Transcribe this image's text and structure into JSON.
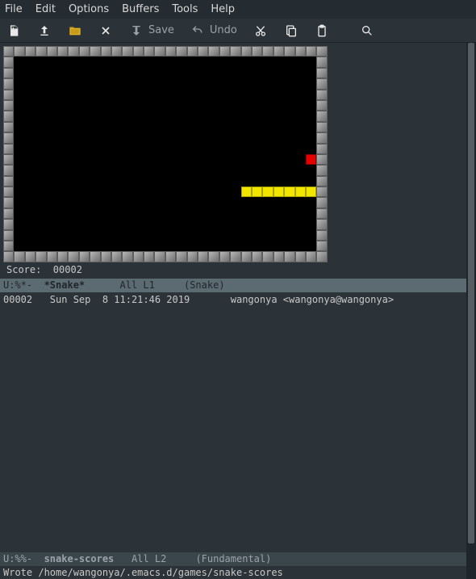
{
  "menu": {
    "file": "File",
    "edit": "Edit",
    "options": "Options",
    "buffers": "Buffers",
    "tools": "Tools",
    "help": "Help"
  },
  "toolbar": {
    "save_label": "Save",
    "undo_label": "Undo"
  },
  "game": {
    "cols": 30,
    "rows": 20,
    "food": {
      "col": 28,
      "row": 10
    },
    "snake_row": 13,
    "snake_start_col": 22,
    "snake_end_col": 28,
    "score_label": "Score:  ",
    "score_value": "00002"
  },
  "modeline1": {
    "left": "U:%*-  ",
    "buffer": "*Snake*",
    "mid": "      All L1     ",
    "mode": "(Snake)"
  },
  "scores_buffer": {
    "line": "00002   Sun Sep  8 11:21:46 2019       wangonya <wangonya@wangonya>"
  },
  "modeline2": {
    "left": "U:%%-  ",
    "buffer": "snake-scores",
    "mid": "   All L2     ",
    "mode": "(Fundamental)"
  },
  "minibuffer": {
    "text": "Wrote /home/wangonya/.emacs.d/games/snake-scores"
  }
}
